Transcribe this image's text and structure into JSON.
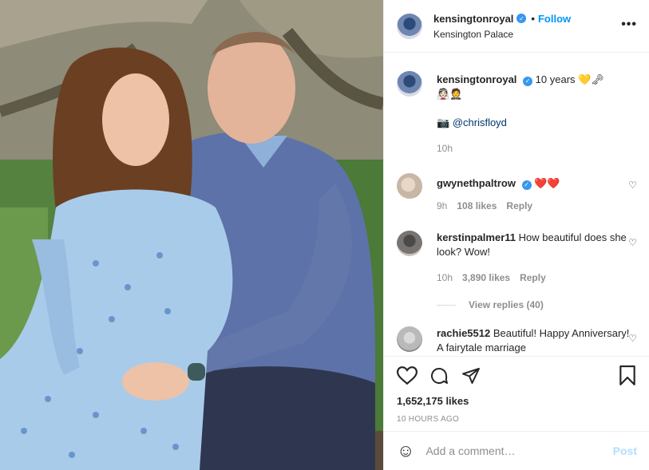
{
  "post": {
    "username": "kensingtonroyal",
    "follow_label": "Follow",
    "location": "Kensington Palace",
    "more_label": "•••"
  },
  "caption": {
    "username": "kensingtonroyal",
    "text": "10 years",
    "emojis": "💛🗝",
    "emojis_line2": "👰🏻🤵",
    "camera_emoji": "📷",
    "credit": "@chrisfloyd",
    "time": "10h"
  },
  "comments": [
    {
      "username": "gwynethpaltrow",
      "text": "❤️❤️",
      "time": "9h",
      "likes": "108 likes",
      "reply_label": "Reply"
    },
    {
      "username": "kerstinpalmer11",
      "text": "How beautiful does she look? Wow!",
      "time": "10h",
      "likes": "3,890 likes",
      "reply_label": "Reply",
      "view_replies": "View replies (40)"
    },
    {
      "username": "rachie5512",
      "text": "Beautiful! Happy Anniversary! A fairytale marriage"
    }
  ],
  "stats": {
    "likes": "1,652,175 likes",
    "time_ago": "10 HOURS AGO"
  },
  "add_comment": {
    "placeholder": "Add a comment…",
    "post_label": "Post",
    "emoji_icon": "☺"
  },
  "colors": {
    "accent": "#0095f6",
    "verified": "#3897f0",
    "post_disabled": "#b2dffc"
  }
}
